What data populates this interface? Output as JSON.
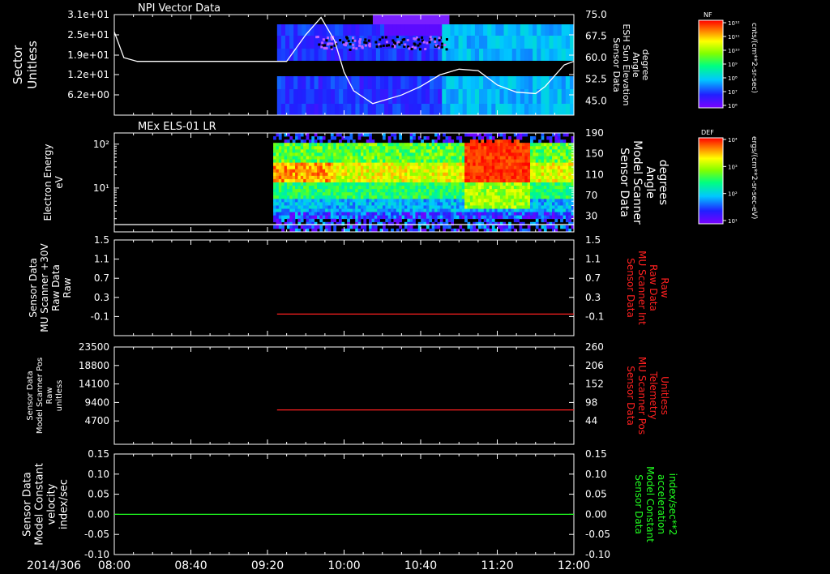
{
  "time_axis": {
    "date_label": "2014/306",
    "ticks": [
      "08:00",
      "08:40",
      "09:20",
      "10:00",
      "10:40",
      "11:20",
      "12:00"
    ],
    "range_minutes": [
      0,
      240
    ]
  },
  "chart_data": [
    {
      "type": "heatmap",
      "title": "NPI Vector Data",
      "ylabel_lines": [
        "Sector",
        "Unitless"
      ],
      "yticks": [
        "3.1e+01",
        "2.5e+01",
        "1.9e+01",
        "1.2e+01",
        "6.2e+00"
      ],
      "right_ylabel_lines": [
        "Sensor Data",
        "ESH Sun Elevation",
        "Angle",
        "degree"
      ],
      "right_yticks": [
        "75.0",
        "67.5",
        "60.0",
        "52.5",
        "45.0"
      ],
      "right_ylim": [
        40,
        75
      ],
      "colorbar": {
        "label": "NF",
        "units": "cnts/(cm**2-sr-sec)",
        "ticks": [
          "10¹²",
          "10¹¹",
          "10¹⁰",
          "10⁹",
          "10⁸",
          "10⁷",
          "10⁶"
        ]
      },
      "data_start_minutes": 85,
      "overlay_line": {
        "axis": "right",
        "minutes": [
          0,
          5,
          12,
          25,
          40,
          60,
          75,
          90,
          100,
          108,
          115,
          120,
          125,
          135,
          150,
          160,
          170,
          180,
          190,
          200,
          210,
          220,
          225,
          235,
          240
        ],
        "values": [
          69,
          60,
          58.7,
          58.7,
          58.7,
          58.7,
          58.7,
          58.7,
          68,
          74,
          66,
          55,
          48.5,
          44,
          47,
          50,
          54,
          56,
          55.5,
          50.5,
          48,
          47.5,
          50,
          57.5,
          58.7
        ]
      }
    },
    {
      "type": "heatmap",
      "title": "MEx ELS-01 LR",
      "ylabel_lines": [
        "Electron Energy",
        "eV"
      ],
      "yticks_log": [
        {
          "label": "10²",
          "value": 100
        },
        {
          "label": "10¹",
          "value": 10
        }
      ],
      "ylim_log": [
        1,
        180
      ],
      "right_ylabel_lines": [
        "Sensor Data",
        "Model Scanner",
        "Angle",
        "degrees"
      ],
      "right_yticks": [
        "190",
        "150",
        "110",
        "70",
        "30"
      ],
      "right_ylim": [
        0,
        190
      ],
      "colorbar": {
        "label": "DEF",
        "units": "ergs/(cm**2-sr-sec-eV)",
        "ticks": [
          "10⁴",
          "10³",
          "10²",
          "10¹"
        ]
      },
      "data_start_minutes": 83,
      "overlay_line": {
        "axis": "right",
        "minutes": [
          0,
          240
        ],
        "values": [
          14,
          14
        ]
      }
    },
    {
      "type": "line",
      "ylabel_lines": [
        "Sensor Data",
        "MU Scanner +30V",
        "Raw Data",
        "Raw"
      ],
      "yticks": [
        "1.5",
        "1.1",
        "0.7",
        "0.3",
        "-0.1"
      ],
      "ylim": [
        -0.5,
        1.5
      ],
      "right_ylabel_lines": [
        "Sensor Data",
        "MU Scanner Int",
        "Raw Data",
        "Raw"
      ],
      "right_yticks": [
        "1.5",
        "1.1",
        "0.7",
        "0.3",
        "-0.1"
      ],
      "series": [
        {
          "color": "#ff2020",
          "minutes": [
            85,
            240
          ],
          "values": [
            -0.05,
            -0.05
          ]
        }
      ]
    },
    {
      "type": "line",
      "ylabel_lines": [
        "Sensor Data",
        "Model Scanner Pos",
        "Raw",
        "unitless"
      ],
      "yticks": [
        "23500",
        "18800",
        "14100",
        "9400",
        "4700"
      ],
      "ylim": [
        0,
        23500
      ],
      "right_ylabel_lines": [
        "Sensor Data",
        "MU Scanner Pos",
        "Telemetry",
        "Unitless"
      ],
      "right_yticks": [
        "260",
        "206",
        "152",
        "98",
        "44"
      ],
      "series": [
        {
          "color": "#ff2020",
          "minutes": [
            85,
            240
          ],
          "values": [
            7500,
            7500
          ]
        }
      ]
    },
    {
      "type": "line",
      "ylabel_lines": [
        "Sensor Data",
        "Model Constant",
        "velocity",
        "index/sec"
      ],
      "yticks": [
        "0.15",
        "0.10",
        "0.05",
        "0.00",
        "-0.05",
        "-0.10"
      ],
      "ylim": [
        -0.1,
        0.15
      ],
      "right_ylabel_lines": [
        "Sensor Data",
        "Model Constant",
        "acceleration",
        "index/sec**2"
      ],
      "right_yticks": [
        "0.15",
        "0.10",
        "0.05",
        "0.00",
        "-0.05",
        "-0.10"
      ],
      "series": [
        {
          "color": "#20ff20",
          "minutes": [
            0,
            240
          ],
          "values": [
            0,
            0
          ]
        }
      ]
    }
  ],
  "colors": {
    "red_label": "#ff2020",
    "green_label": "#20ff20"
  }
}
